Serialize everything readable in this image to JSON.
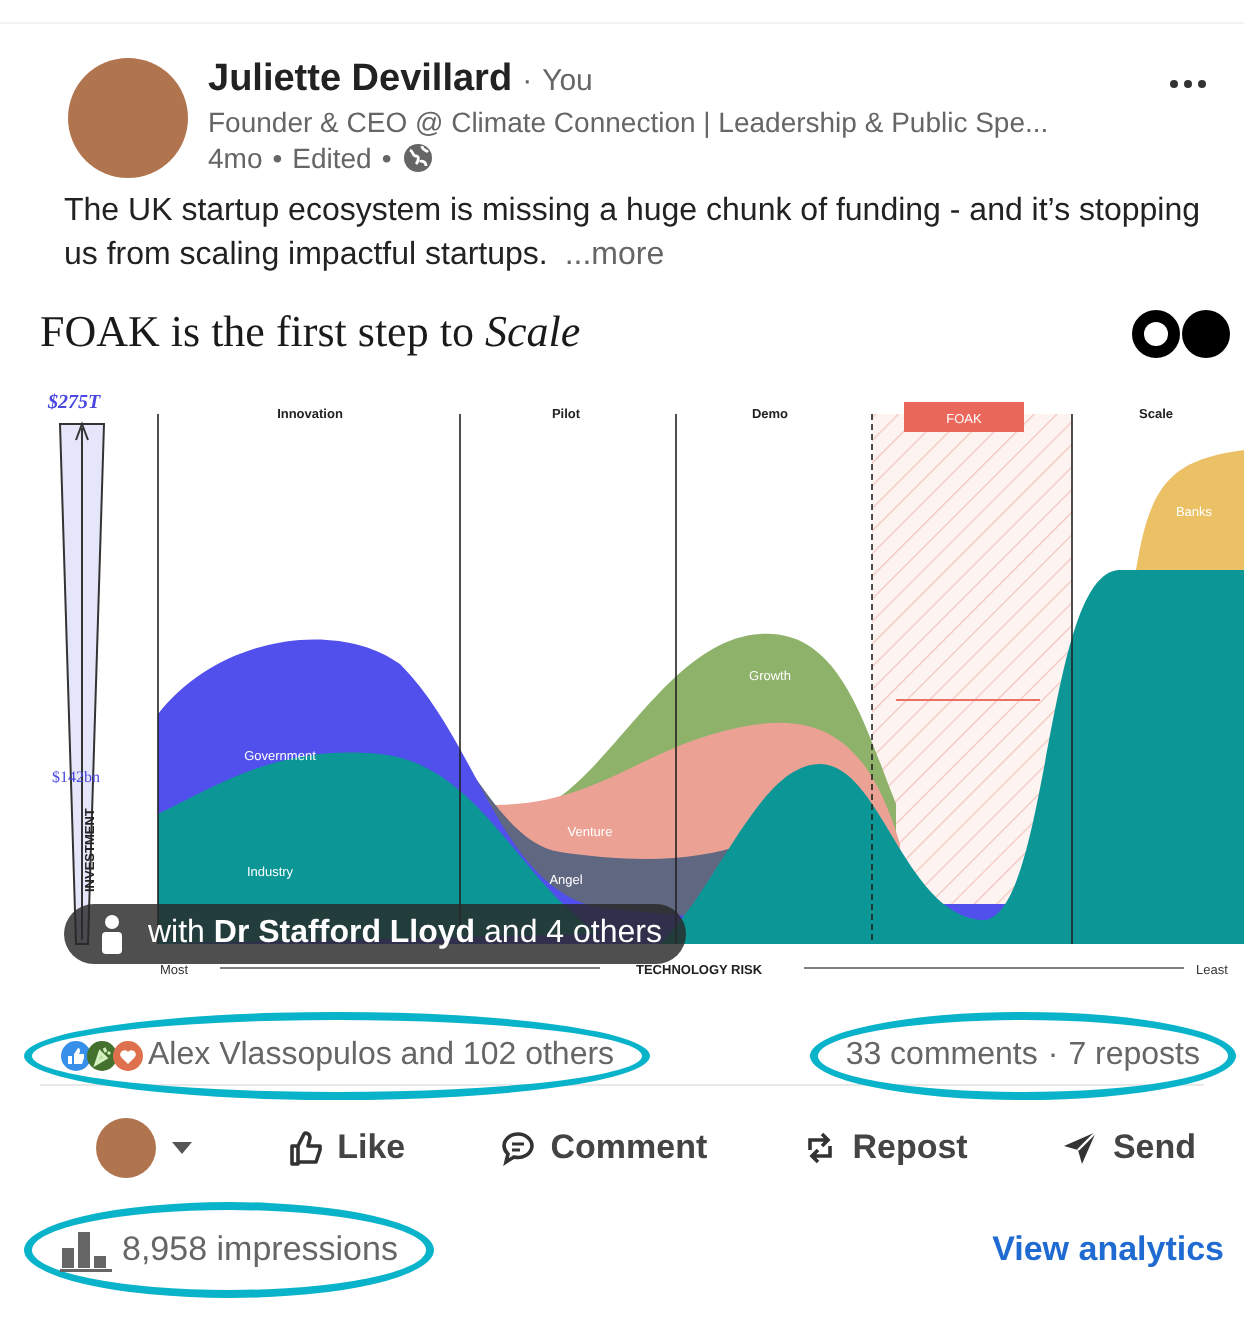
{
  "author": {
    "name": "Juliette Devillard",
    "badge": "You",
    "headline": "Founder & CEO @ Climate Connection | Leadership & Public Spe...",
    "time": "4mo",
    "edited": "Edited"
  },
  "post": {
    "text": "The UK startup ecosystem is missing a huge chunk of funding - and it’s stopping us from scaling impactful startups.",
    "more": "...more"
  },
  "image": {
    "title": "FOAK is the first step to *Scale*",
    "stages": [
      {
        "label": "Innovation",
        "kind": "plain"
      },
      {
        "label": "Pilot",
        "kind": "plain"
      },
      {
        "label": "Demo",
        "kind": "plain"
      },
      {
        "label": "FOAK",
        "kind": "focus"
      },
      {
        "label": "Scale",
        "kind": "plain"
      }
    ],
    "areas": [
      "Banks",
      "Growth",
      "Government",
      "Venture",
      "Industry",
      "Angel"
    ],
    "axis": {
      "top": "$275T",
      "mid": "$142bn",
      "y_title": "INVESTMENT",
      "x_title": "TECHNOLOGY RISK",
      "x_start": "Most",
      "x_end": "Least"
    },
    "tag_overlay": "with **Dr Stafford Lloyd** and 4 others"
  },
  "reactions": {
    "text": "Alex Vlassopulos and 102 others",
    "highlighted": true
  },
  "counts": {
    "comments": "33 comments",
    "reposts": "7 reposts",
    "highlighted": true
  },
  "actions": [
    {
      "label": "Like",
      "kind": "like"
    },
    {
      "label": "Comment",
      "kind": "comment"
    },
    {
      "label": "Repost",
      "kind": "repost"
    },
    {
      "label": "Send",
      "kind": "send"
    }
  ],
  "impressions": {
    "text": "8,958 impressions",
    "highlighted": true
  },
  "analytics_link": "View analytics",
  "separators": {
    "badge": "·",
    "meta": "•",
    "counts": "·"
  }
}
